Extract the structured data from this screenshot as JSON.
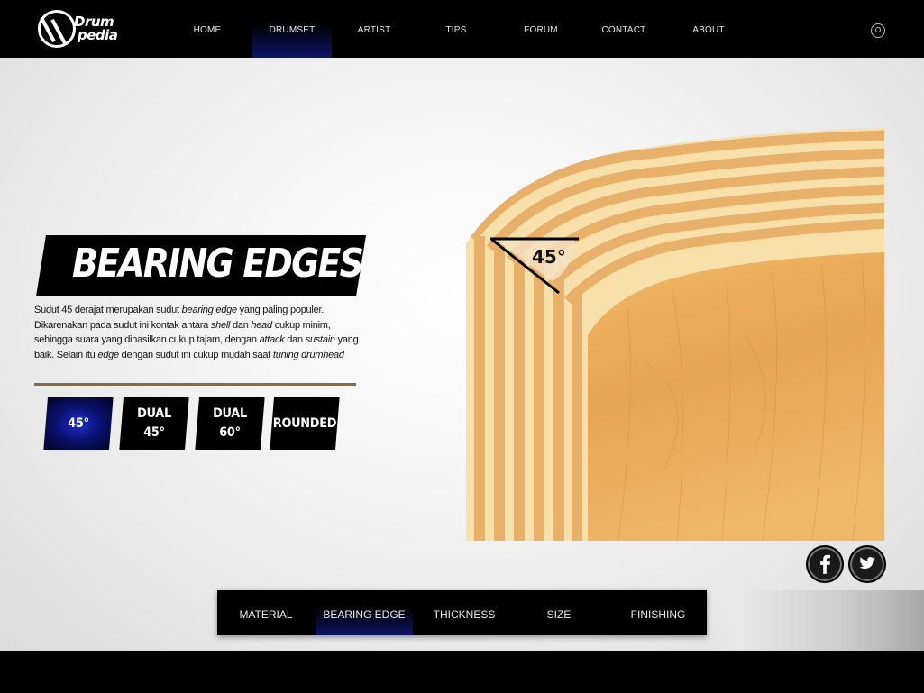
{
  "header": {
    "logo": {
      "line1": "Drum",
      "line2": "pedia"
    },
    "nav": [
      {
        "label": "HOME",
        "active": false
      },
      {
        "label": "DRUMSET",
        "active": true
      },
      {
        "label": "ARTIST",
        "active": false
      },
      {
        "label": "TIPS",
        "active": false
      },
      {
        "label": "FORUM",
        "active": false
      },
      {
        "label": "CONTACT",
        "active": false
      },
      {
        "label": "ABOUT",
        "active": false
      }
    ],
    "search_icon": "search-icon"
  },
  "content": {
    "title": "BEARING EDGES",
    "description": {
      "p1": "Sudut 45 derajat merupakan sudut ",
      "i1": "bearing edge",
      "p2": " yang paling populer. Dikarenakan pada sudut ini kontak antara ",
      "i2": "shell",
      "p3": " dan ",
      "i3": "head",
      "p4": " cukup minim, sehingga suara yang dihasilkan cukup tajam, dengan ",
      "i4": "attack",
      "p5": " dan ",
      "i5": "sustain",
      "p6": " yang baik. Selain itu ",
      "i6": "edge",
      "p7": " dengan sudut ini cukup mudah saat ",
      "i7": "tuning drumhead"
    },
    "edge_options": [
      {
        "line1": "45°",
        "line2": "",
        "active": true
      },
      {
        "line1": "DUAL",
        "line2": "45°",
        "active": false
      },
      {
        "line1": "DUAL",
        "line2": "60°",
        "active": false
      },
      {
        "line1": "ROUNDED",
        "line2": "",
        "active": false
      }
    ],
    "illustration": {
      "angle_label": "45°"
    }
  },
  "bottom_tabs": [
    {
      "label": "MATERIAL",
      "active": false
    },
    {
      "label": "BEARING EDGE",
      "active": true
    },
    {
      "label": "THICKNESS",
      "active": false
    },
    {
      "label": "SIZE",
      "active": false
    },
    {
      "label": "FINISHING",
      "active": false
    }
  ],
  "social": [
    {
      "name": "facebook-icon",
      "glyph": "f"
    },
    {
      "name": "twitter-icon",
      "glyph": "t"
    }
  ],
  "colors": {
    "accent": "#0d1466",
    "rule": "#8a6a45",
    "wood_light": "#f6dca4",
    "wood_dark": "#e0a45a"
  }
}
